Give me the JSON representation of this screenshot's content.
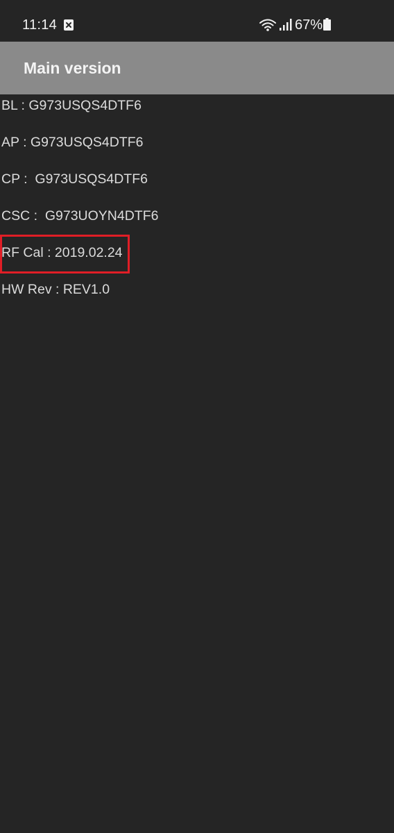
{
  "status_bar": {
    "time": "11:14",
    "battery_percent": "67%",
    "icons": [
      "notification-icon",
      "wifi-icon",
      "signal-icon",
      "battery-icon"
    ]
  },
  "app_bar": {
    "title": "Main version"
  },
  "versions": {
    "bl": "BL : G973USQS4DTF6",
    "ap": "AP : G973USQS4DTF6",
    "cp": "CP :  G973USQS4DTF6",
    "csc": "CSC :  G973UOYN4DTF6",
    "rf_cal": "RF Cal : 2019.02.24",
    "hw_rev": "HW Rev : REV1.0"
  },
  "colors": {
    "background": "#252525",
    "app_bar": "#8a8a8a",
    "highlight_border": "#e01e26"
  }
}
